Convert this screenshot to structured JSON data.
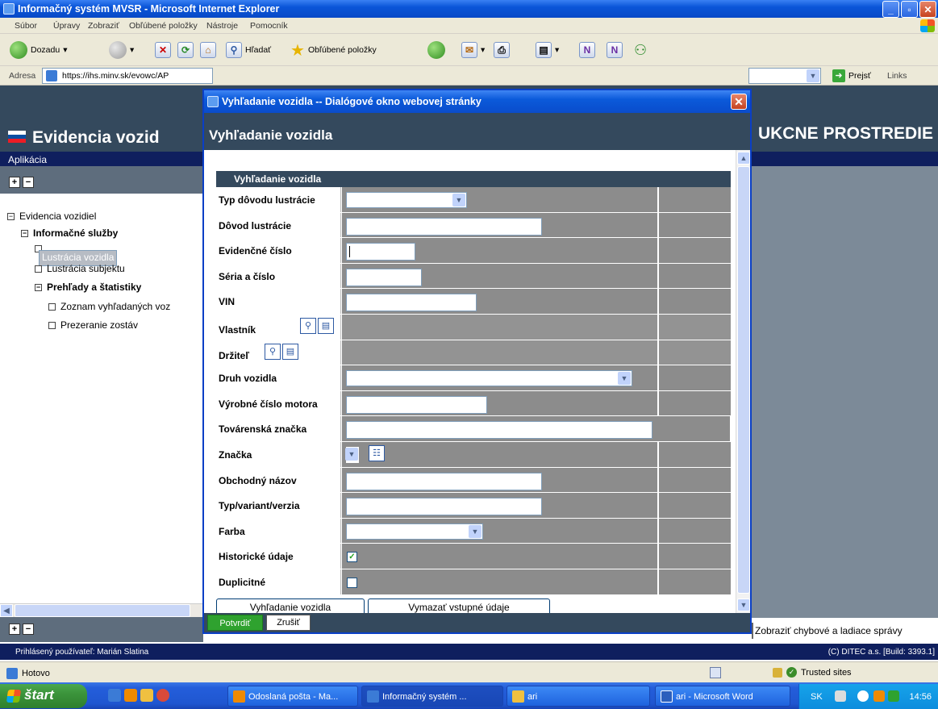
{
  "ie": {
    "title": "Informačný systém MVSR - Microsoft Internet Explorer",
    "menu": [
      "Súbor",
      "Úpravy",
      "Zobraziť",
      "Obľúbené položky",
      "Nástroje",
      "Pomocník"
    ],
    "toolbar": {
      "back": "Dozadu",
      "search": "Hľadať",
      "favorites": "Obľúbené položky"
    },
    "address_label": "Adresa",
    "address": "https://ihs.minv.sk/evowc/AP",
    "go": "Prejsť",
    "links": "Links",
    "status": "Hotovo",
    "zone": "Trusted sites"
  },
  "app": {
    "title": "Evidencia vozid",
    "title_right": "UKCNE PROSTREDIE",
    "menu": "Aplikácia",
    "tree": {
      "root": "Evidencia vozidiel",
      "group1": "Informačné služby",
      "item1": "Lustrácia vozidla",
      "item2": "Lustrácia subjektu",
      "group2": "Prehľady a štatistiky",
      "item3": "Zoznam vyhľadaných voz",
      "item4": "Prezeranie zostáv"
    },
    "debug": "Zobraziť chybové a ladiace správy",
    "user": "Prihlásený používateľ: Marián Slatina",
    "copyright": "(C) DITEC a.s. [Build: 3393.1]"
  },
  "dialog": {
    "title": "Vyhľadanie vozidla -- Dialógové okno webovej stránky",
    "heading": "Vyhľadanie vozidla",
    "form_header": "Vyhľadanie vozidla",
    "fields": {
      "typ_dovodu": "Typ dôvodu lustrácie",
      "dovod": "Dôvod lustrácie",
      "ec": "Evidenčné číslo",
      "seria": "Séria a číslo",
      "vin": "VIN",
      "vlastnik": "Vlastník",
      "drzitel": "Držiteľ",
      "druh": "Druh vozidla",
      "motor": "Výrobné číslo motora",
      "tovarenska": "Továrenská značka",
      "znacka": "Značka",
      "obchodny": "Obchodný názov",
      "typ": "Typ/variant/verzia",
      "farba": "Farba",
      "historicke": "Historické údaje",
      "duplicitne": "Duplicitné"
    },
    "historicke_checked": true,
    "duplicitne_checked": false,
    "btn_search": "Vyhľadanie vozidla",
    "btn_clear": "Vymazať vstupné údaje",
    "btn_ok": "Potvrdiť",
    "btn_cancel": "Zrušiť"
  },
  "taskbar": {
    "start": "štart",
    "tasks": [
      "Odoslaná pošta - Ma...",
      "Informačný systém ...",
      "ari",
      "ari - Microsoft Word"
    ],
    "lang": "SK",
    "clock": "14:56"
  }
}
